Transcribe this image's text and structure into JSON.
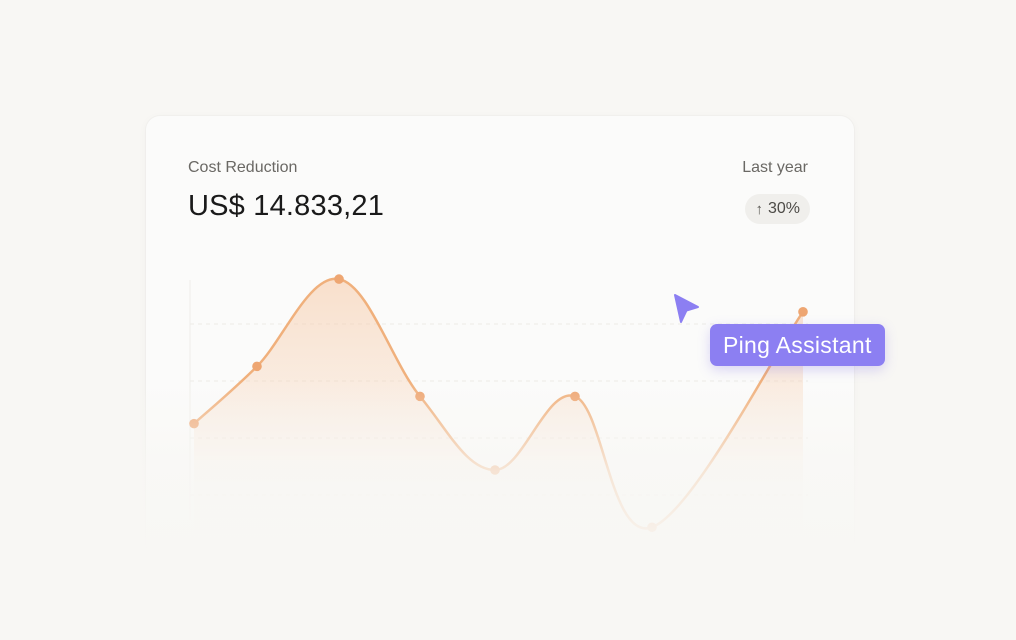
{
  "card": {
    "title": "Cost Reduction",
    "value": "US$ 14.833,21",
    "period": "Last year",
    "change": "30%",
    "change_direction": "up"
  },
  "assistant": {
    "label": "Ping Assistant",
    "color": "#8c7ff2"
  },
  "colors": {
    "line": "#f0b07c",
    "dot": "#eea672",
    "fill_top": "#f7c9a6"
  },
  "chart_data": {
    "type": "area",
    "series": [
      {
        "values": [
          30,
          51,
          83,
          40,
          13,
          40,
          -8,
          71
        ]
      }
    ],
    "ylim": [
      -20,
      90
    ],
    "grid": true
  }
}
